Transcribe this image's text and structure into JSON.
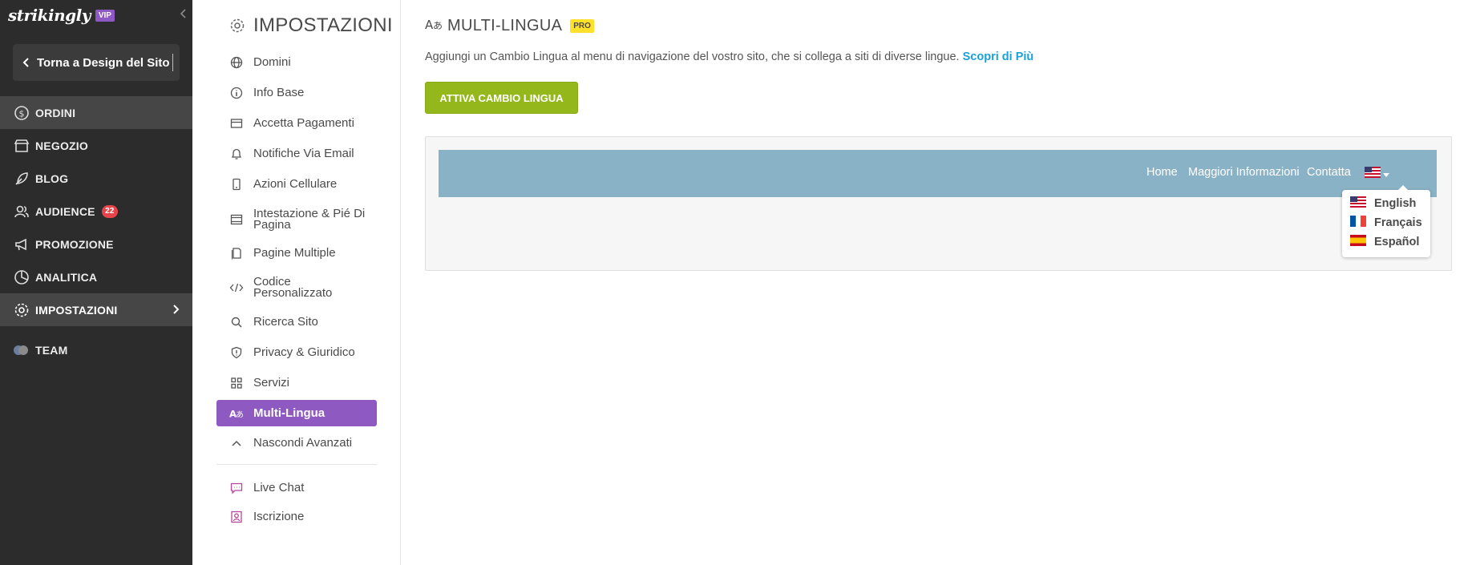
{
  "brand": {
    "logo": "strikingly",
    "badge": "VIP"
  },
  "sidebar": {
    "back_label": "Torna a Design del Sito",
    "items": [
      {
        "label": "ORDINI",
        "icon": "dollar-circle-icon"
      },
      {
        "label": "NEGOZIO",
        "icon": "store-icon"
      },
      {
        "label": "BLOG",
        "icon": "feather-icon"
      },
      {
        "label": "AUDIENCE",
        "icon": "users-icon",
        "badge": "22"
      },
      {
        "label": "PROMOZIONE",
        "icon": "megaphone-icon"
      },
      {
        "label": "ANALITICA",
        "icon": "pie-chart-icon"
      },
      {
        "label": "IMPOSTAZIONI",
        "icon": "gear-icon"
      },
      {
        "label": "TEAM",
        "icon": "team-avatars-icon"
      }
    ]
  },
  "settings": {
    "title": "IMPOSTAZIONI",
    "items": [
      {
        "label": "Domini",
        "icon": "globe-icon"
      },
      {
        "label": "Info Base",
        "icon": "info-icon"
      },
      {
        "label": "Accetta Pagamenti",
        "icon": "card-icon"
      },
      {
        "label": "Notifiche Via Email",
        "icon": "bell-icon"
      },
      {
        "label": "Azioni Cellulare",
        "icon": "phone-icon"
      },
      {
        "label": "Intestazione & Pié Di Pagina",
        "icon": "layout-icon"
      },
      {
        "label": "Pagine Multiple",
        "icon": "pages-icon"
      },
      {
        "label": "Codice Personalizzato",
        "icon": "code-icon"
      },
      {
        "label": "Ricerca Sito",
        "icon": "search-icon"
      },
      {
        "label": "Privacy & Giuridico",
        "icon": "shield-icon"
      },
      {
        "label": "Servizi",
        "icon": "grid-icon"
      },
      {
        "label": "Multi-Lingua",
        "icon": "translate-icon"
      },
      {
        "label": "Nascondi Avanzati",
        "icon": "chevron-up-icon"
      },
      {
        "label": "Live Chat",
        "icon": "chat-icon"
      },
      {
        "label": "Iscrizione",
        "icon": "profile-icon"
      }
    ]
  },
  "main": {
    "title": "MULTI-LINGUA",
    "badge": "PRO",
    "description": "Aggiungi un Cambio Lingua al menu di navigazione del vostro sito, che si collega a siti di diverse lingue.",
    "learn_more": "Scopri di Più",
    "activate_button": "ATTIVA CAMBIO LINGUA",
    "preview": {
      "nav_links": [
        "Home",
        "Maggiori Informazioni",
        "Contatta"
      ],
      "languages": [
        {
          "label": "English",
          "flag": "us-flag-icon"
        },
        {
          "label": "Français",
          "flag": "fr-flag-icon"
        },
        {
          "label": "Español",
          "flag": "es-flag-icon"
        }
      ]
    }
  },
  "colors": {
    "sidebar_bg": "#2c2c2c",
    "active_purple": "#8f59c2",
    "button_green": "#94b81c",
    "link_blue": "#1aa1d9",
    "preview_nav": "#8ab2c6",
    "badge_red": "#e5454a",
    "pro_yellow": "#ffe12b"
  }
}
